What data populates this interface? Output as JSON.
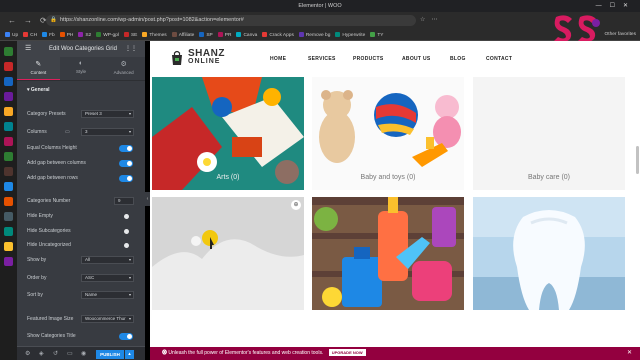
{
  "browser": {
    "window_title": "Elementor | WOO",
    "url": "https://shanzonline.com/wp-admin/post.php?post=1082&action=elementor#",
    "bookmarks": [
      "Up",
      "CH",
      "Fb",
      "PH",
      "S2",
      "WP-gpl",
      "SE",
      "Themes",
      "Affiliate",
      "SP",
      "PR",
      "Canva",
      "Crack Apps",
      "Remove bg",
      "Hyperwrite",
      "TY"
    ],
    "bookmark_colors": [
      "#3b82f6",
      "#e53935",
      "#1e88e5",
      "#e65100",
      "#8e24aa",
      "#2e7d32",
      "#c62828",
      "#f9a825",
      "#6d4c41",
      "#1565c0",
      "#ad1457",
      "#00acc1",
      "#e53935",
      "#5e35b1",
      "#00897b",
      "#43a047"
    ],
    "other_bookmarks": "Other favorites",
    "overlay_logo_text": "SOCIAL EXPERT"
  },
  "panel": {
    "title": "Edit Woo Categories Grid",
    "tabs": [
      {
        "label": "Content",
        "icon": "pencil-icon"
      },
      {
        "label": "Style",
        "icon": "half-circle-icon"
      },
      {
        "label": "Advanced",
        "icon": "gear-icon"
      }
    ],
    "section": "General",
    "fields": {
      "category_presets": {
        "label": "Category Presets",
        "value": "Preset 3"
      },
      "columns": {
        "label": "Columns",
        "value": "3"
      },
      "equal_columns_height": {
        "label": "Equal Columns Height",
        "on": true
      },
      "gap_columns": {
        "label": "Add gap between columns",
        "on": true
      },
      "gap_rows": {
        "label": "Add gap between rows",
        "on": true
      },
      "categories_number": {
        "label": "Categories Number",
        "value": "9"
      },
      "hide_empty": {
        "label": "Hide Empty",
        "on": false
      },
      "hide_subcategories": {
        "label": "Hide Subcategories",
        "on": false
      },
      "hide_uncategorized": {
        "label": "Hide Uncategorized",
        "on": false
      },
      "show_by": {
        "label": "Show by",
        "value": "All"
      },
      "order_by": {
        "label": "Order by",
        "value": "ASC"
      },
      "sort_by": {
        "label": "Sort by",
        "value": "Name"
      },
      "featured_image_size": {
        "label": "Featured Image Size",
        "value": "Woocommerce Thur"
      },
      "show_categories_title": {
        "label": "Show Categories Title",
        "on": true
      }
    },
    "publish_label": "PUBLISH"
  },
  "site": {
    "logo_line1": "SHANZ",
    "logo_line2": "ONLINE",
    "nav": [
      "HOME",
      "SERVICES",
      "PRODUCTS",
      "ABOUT US",
      "BLOG",
      "CONTACT"
    ],
    "categories": [
      {
        "name": "Arts",
        "count": "(0)"
      },
      {
        "name": "Baby and toys",
        "count": "(0)"
      },
      {
        "name": "Baby care",
        "count": "(0)"
      },
      {
        "name": "",
        "count": ""
      },
      {
        "name": "",
        "count": ""
      },
      {
        "name": "",
        "count": ""
      }
    ]
  },
  "promo": {
    "text": "Unleash the full power of Elementor's features and web creation tools.",
    "button": "UPGRADE NOW"
  }
}
